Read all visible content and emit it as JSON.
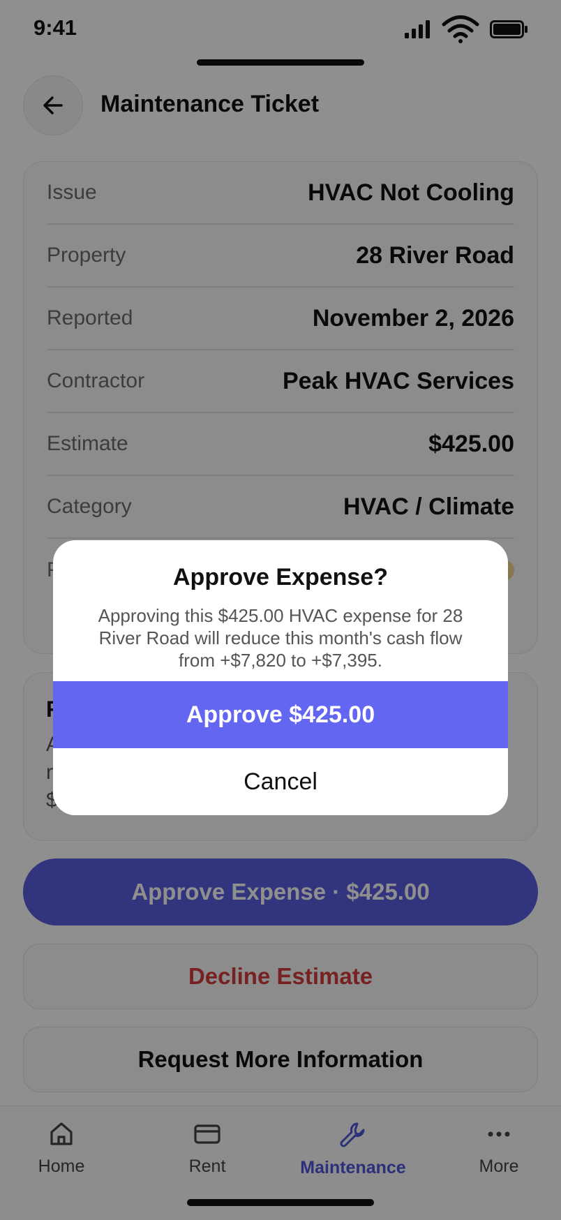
{
  "status_bar": {
    "time": "9:41"
  },
  "header": {
    "title": "Maintenance Ticket"
  },
  "details": [
    {
      "label": "Issue",
      "value": "HVAC Not Cooling"
    },
    {
      "label": "Property",
      "value": "28 River Road"
    },
    {
      "label": "Reported",
      "value": "November 2, 2026"
    },
    {
      "label": "Contractor",
      "value": "Peak HVAC Services"
    },
    {
      "label": "Estimate",
      "value": "$425.00"
    },
    {
      "label": "Category",
      "value": "HVAC / Climate"
    },
    {
      "label": "P",
      "value": ""
    }
  ],
  "summary": {
    "title": "F",
    "text": "A\nn\n$"
  },
  "actions": {
    "approve": "Approve Expense · $425.00",
    "decline": "Decline Estimate",
    "request": "Request More Information"
  },
  "tabs": [
    {
      "label": "Home",
      "icon": "home-icon"
    },
    {
      "label": "Rent",
      "icon": "card-icon"
    },
    {
      "label": "Maintenance",
      "icon": "wrench-icon"
    },
    {
      "label": "More",
      "icon": "more-icon"
    }
  ],
  "dialog": {
    "title": "Approve Expense?",
    "message": "Approving this $425.00 HVAC expense for 28 River Road will reduce this month's cash flow from +$7,820 to +$7,395.",
    "confirm": "Approve $425.00",
    "cancel": "Cancel"
  },
  "colors": {
    "accent": "#6366f1",
    "decline": "#d53d3d",
    "overlay": "rgba(0,0,0,0.44)"
  }
}
